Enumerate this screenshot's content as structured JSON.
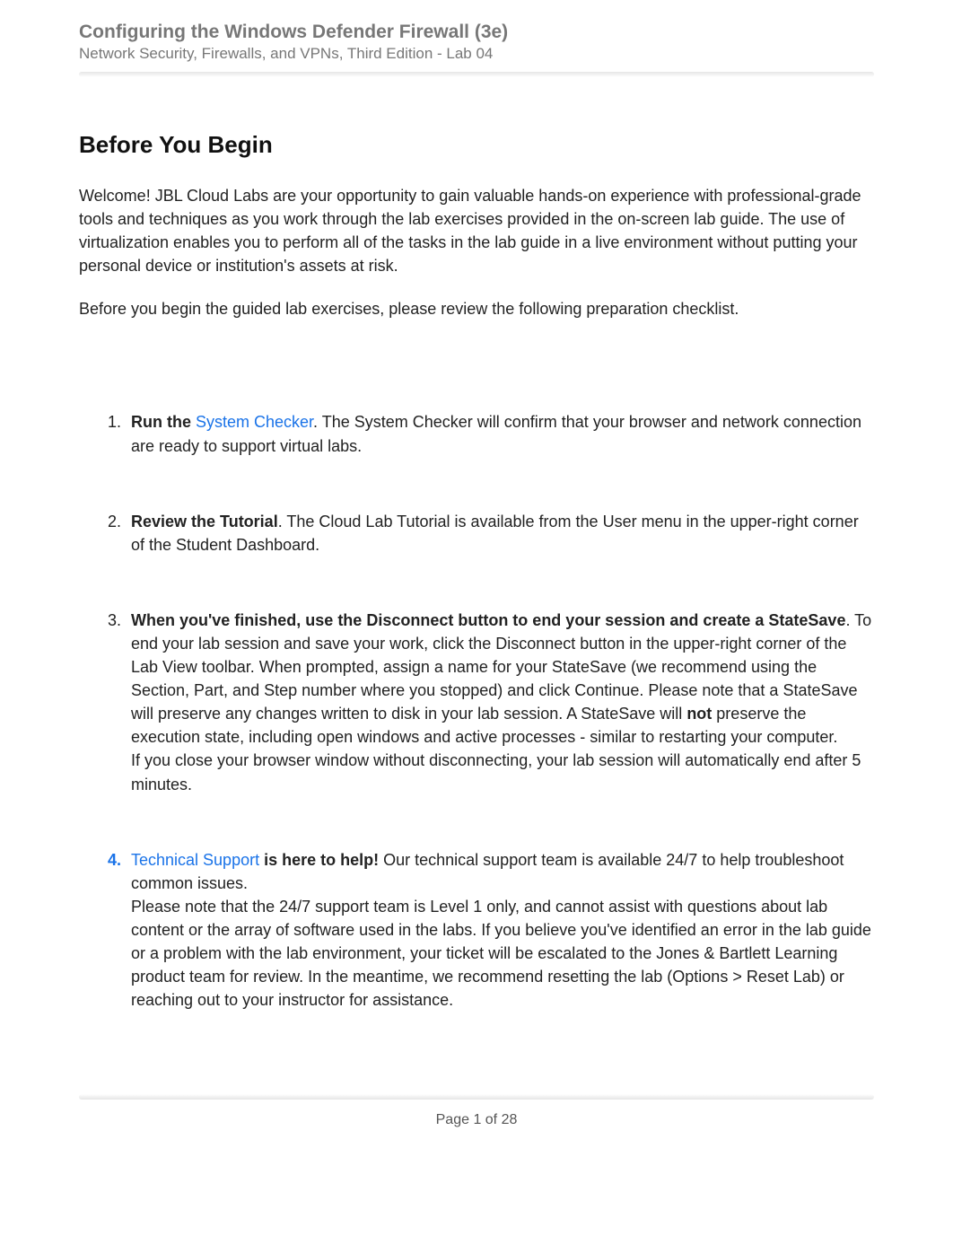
{
  "header": {
    "title": "Configuring the Windows Defender Firewall (3e)",
    "subtitle": "Network Security, Firewalls, and VPNs, Third Edition - Lab 04"
  },
  "section": {
    "heading": "Before You Begin",
    "intro1": "Welcome! JBL Cloud Labs are your opportunity to gain valuable hands-on experience with professional-grade tools and techniques as you work through the lab exercises provided in the on-screen lab guide. The use of virtualization enables you to perform all of the tasks in the lab guide in a live environment without putting your personal device or institution's assets at risk.",
    "intro2": "Before you begin the guided lab exercises, please review the following preparation checklist."
  },
  "items": {
    "i1": {
      "bold_prefix": "Run the ",
      "link_text": "System Checker",
      "rest": ". The System Checker will confirm that your browser and network connection are ready to support virtual labs."
    },
    "i2": {
      "bold_prefix": "Review the Tutorial",
      "rest": ". The Cloud Lab Tutorial is available from the User menu in the upper-right corner of the Student Dashboard."
    },
    "i3": {
      "bold_prefix": "When you've finished, use the Disconnect button to end your session and create a StateSave",
      "rest1": ". To end your lab session and save your work, click the Disconnect button in the upper-right corner of the Lab View toolbar. When prompted, assign a name for your StateSave (we recommend using the Section, Part, and Step number where you stopped) and click Continue. Please note that a StateSave will preserve any changes written to disk in your lab session. A StateSave will ",
      "bold_not": "not",
      "rest2": " preserve the execution state, including open windows and active processes - similar to restarting your computer.",
      "line2": "If you close your browser window without disconnecting, your lab session will automatically end after 5 minutes."
    },
    "i4": {
      "link_text": "Technical Support",
      "bold_mid": " is here to help!",
      "rest1": " Our technical support team is available 24/7 to help troubleshoot common issues.",
      "line2": "Please note that the 24/7 support team is Level 1 only, and cannot assist with questions about lab content or the array of software used in the labs. If you believe you've identified an error in the lab guide or a problem with the lab environment, your ticket will be escalated to the Jones & Bartlett Learning product team for review. In the meantime, we recommend resetting the lab (Options > Reset Lab) or reaching out to your instructor for assistance."
    }
  },
  "footer": {
    "page_label": "Page 1 of 28"
  }
}
